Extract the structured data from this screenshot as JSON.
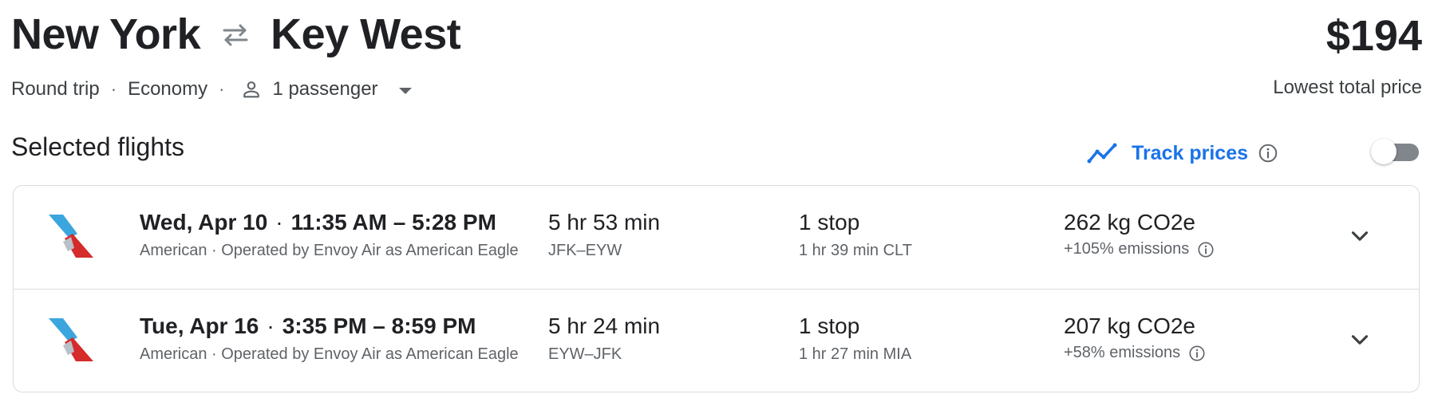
{
  "header": {
    "origin": "New York",
    "destination": "Key West",
    "trip_type": "Round trip",
    "cabin": "Economy",
    "passengers": "1 passenger",
    "price": "$194",
    "price_label": "Lowest total price"
  },
  "section": {
    "title": "Selected flights",
    "track_label": "Track prices",
    "track_enabled": false
  },
  "flights": [
    {
      "date": "Wed, Apr 10",
      "time_range": "11:35 AM – 5:28 PM",
      "airline": "American · Operated by Envoy Air as American Eagle",
      "duration": "5 hr 53 min",
      "airports": "JFK–EYW",
      "stops": "1 stop",
      "layover": "1 hr 39 min CLT",
      "co2": "262 kg CO2e",
      "emissions": "+105% emissions"
    },
    {
      "date": "Tue, Apr 16",
      "time_range": "3:35 PM – 8:59 PM",
      "airline": "American · Operated by Envoy Air as American Eagle",
      "duration": "5 hr 24 min",
      "airports": "EYW–JFK",
      "stops": "1 stop",
      "layover": "1 hr 27 min MIA",
      "co2": "207 kg CO2e",
      "emissions": "+58% emissions"
    }
  ],
  "colors": {
    "accent": "#1a73e8",
    "text_primary": "#202124",
    "text_secondary": "#5f6368",
    "border": "#dadce0"
  },
  "icons": {
    "swap": "swap-arrows-icon",
    "person": "person-icon",
    "trend": "trending-line-icon",
    "info": "info-icon",
    "expand": "chevron-down-icon",
    "airline": "american-airlines-logo"
  }
}
